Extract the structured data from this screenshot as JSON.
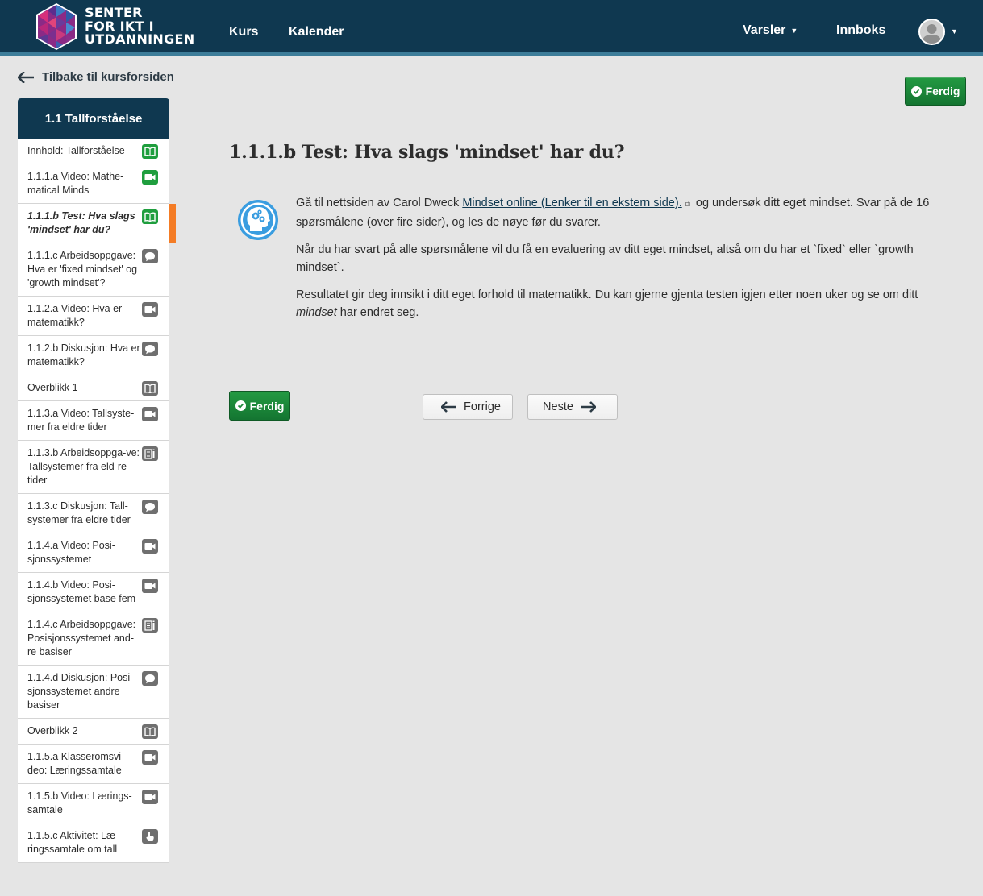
{
  "header": {
    "logo": {
      "line1": "SENTER",
      "line2": "FOR IKT I",
      "line3": "UTDANNINGEN"
    },
    "nav": {
      "kurs": "Kurs",
      "kalender": "Kalender",
      "varsler": "Varsler",
      "innboks": "Innboks"
    },
    "colors": {
      "bar": "#0f3850",
      "stripe": "#3d7d99"
    }
  },
  "back_link": "Tilbake til kursforsiden",
  "sidebar": {
    "title": "1.1 Tallforståelse",
    "items": [
      {
        "label": "Innhold: Tallforståelse",
        "icon": "book-icon",
        "status": "done"
      },
      {
        "label": "1.1.1.a Video: Mathe-matical Minds",
        "icon": "video-icon",
        "status": "done"
      },
      {
        "label": "1.1.1.b Test: Hva slags 'mindset' har du?",
        "icon": "book-icon",
        "status": "done",
        "active": true
      },
      {
        "label": "1.1.1.c Arbeidsoppgave: Hva er 'fixed mindset' og 'growth mindset'?",
        "icon": "chat-icon",
        "status": "todo"
      },
      {
        "label": "1.1.2.a Video: Hva er matematikk?",
        "icon": "video-icon",
        "status": "todo"
      },
      {
        "label": "1.1.2.b Diskusjon: Hva er matematikk?",
        "icon": "chat-icon",
        "status": "todo"
      },
      {
        "label": "Overblikk 1",
        "icon": "book-icon",
        "status": "todo"
      },
      {
        "label": "1.1.3.a Video: Tallsyste-mer fra eldre tider",
        "icon": "video-icon",
        "status": "todo"
      },
      {
        "label": "1.1.3.b Arbeidsoppga-ve: Tallsystemer fra eld-re tider",
        "icon": "assignment-icon",
        "status": "todo"
      },
      {
        "label": "1.1.3.c Diskusjon: Tall-systemer fra eldre tider",
        "icon": "chat-icon",
        "status": "todo"
      },
      {
        "label": "1.1.4.a Video: Posi-sjonssystemet",
        "icon": "video-icon",
        "status": "todo"
      },
      {
        "label": "1.1.4.b Video: Posi-sjonssystemet base fem",
        "icon": "video-icon",
        "status": "todo"
      },
      {
        "label": "1.1.4.c Arbeidsoppgave: Posisjonssystemet and-re basiser",
        "icon": "assignment-icon",
        "status": "todo"
      },
      {
        "label": "1.1.4.d Diskusjon: Posi-sjonssystemet andre basiser",
        "icon": "chat-icon",
        "status": "todo"
      },
      {
        "label": "Overblikk 2",
        "icon": "book-icon",
        "status": "todo"
      },
      {
        "label": "1.1.5.a Klasseromsvi-deo: Læringssamtale",
        "icon": "video-icon",
        "status": "todo"
      },
      {
        "label": "1.1.5.b Video: Lærings-samtale",
        "icon": "video-icon",
        "status": "todo"
      },
      {
        "label": "1.1.5.c Aktivitet: Læ-ringssamtale om tall",
        "icon": "pointer-icon",
        "status": "todo"
      }
    ]
  },
  "main": {
    "ferdig_label": "Ferdig",
    "title": "1.1.1.b Test: Hva slags 'mindset' har du?",
    "p1_before": "Gå til nettsiden av Carol Dweck ",
    "p1_link": "Mindset online (Lenker til en ekstern side).",
    "p1_after": " og undersøk ditt eget mindset. Svar på de 16 spørsmålene (over fire sider), og les de nøye før du svarer.",
    "p2": "Når du har svart på alle spørsmålene vil du få en evaluering av ditt eget mindset, altså om du har et `fixed` eller `growth mindset`.",
    "p3_before": "Resultatet gir deg innsikt i ditt eget forhold til matematikk. Du kan gjerne gjenta testen igjen etter noen uker og se om ditt ",
    "p3_em": "mindset",
    "p3_after": " har endret seg.",
    "prev_label": "Forrige",
    "next_label": "Neste"
  },
  "colors": {
    "done_icon": "#1f9e3e",
    "todo_icon": "#6f6f6f",
    "active_marker": "#f47c25",
    "ferdig_btn": "#1e8a3a"
  }
}
